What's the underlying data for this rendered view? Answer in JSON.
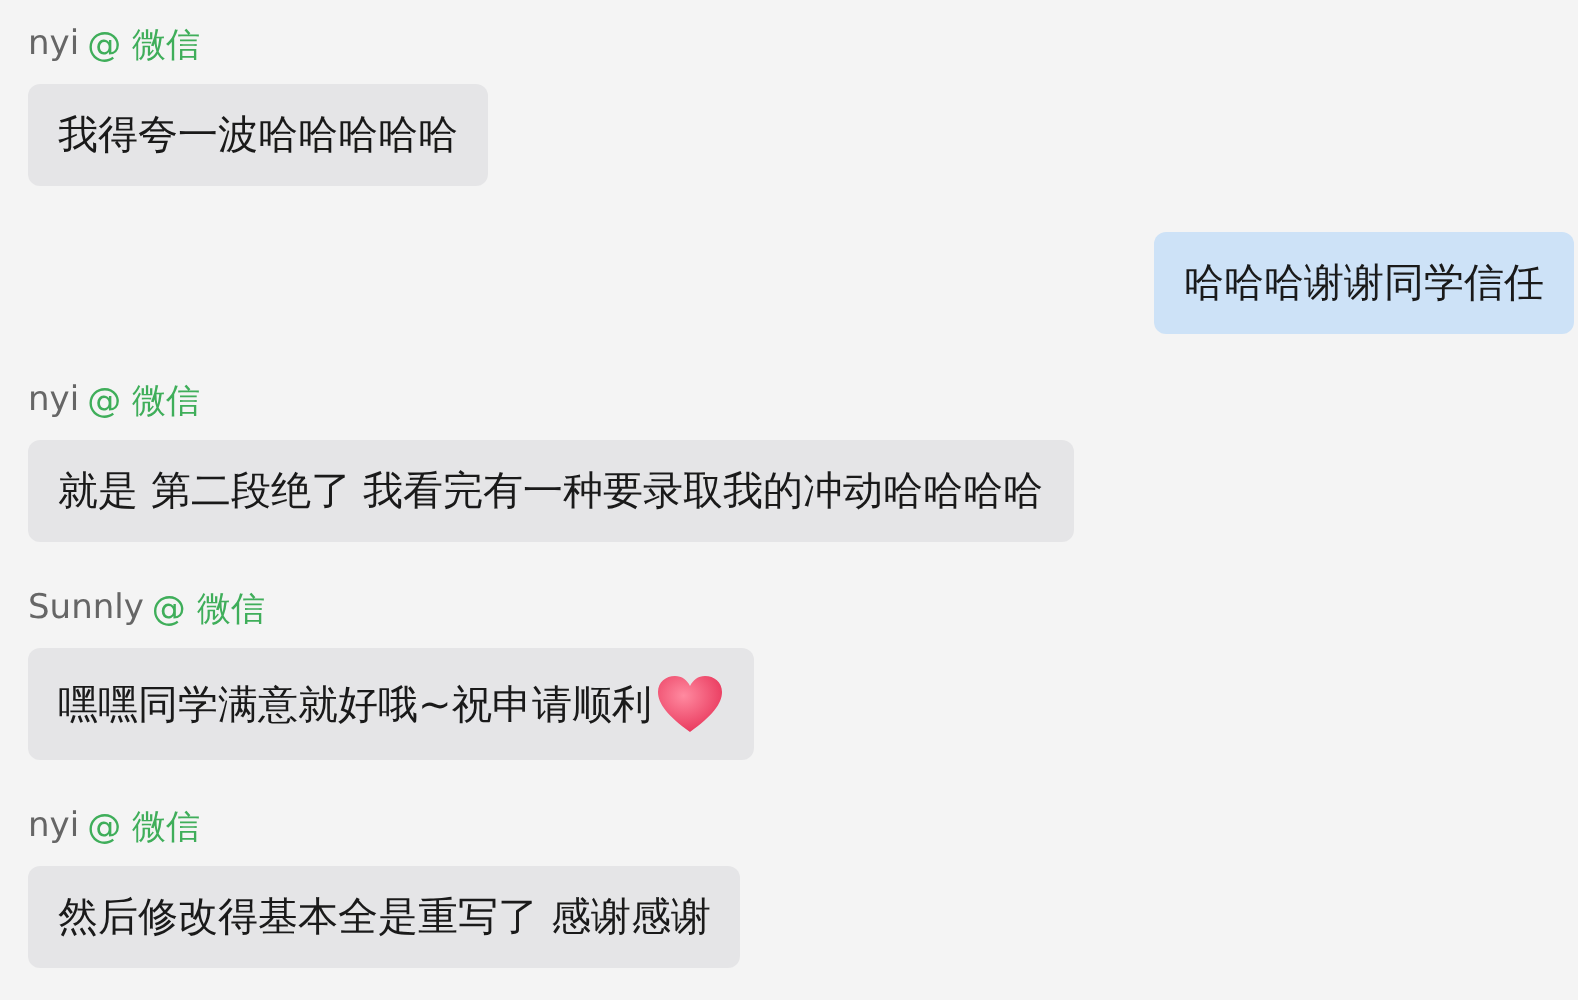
{
  "messages": [
    {
      "kind": "incoming",
      "sender": "nyi",
      "source": "@ 微信",
      "text": "我得夸一波哈哈哈哈哈"
    },
    {
      "kind": "outgoing",
      "text": "哈哈哈谢谢同学信任"
    },
    {
      "kind": "incoming",
      "sender": "nyi",
      "source": "@ 微信",
      "text": "就是 第二段绝了 我看完有一种要录取我的冲动哈哈哈哈"
    },
    {
      "kind": "incoming",
      "sender": "Sunnly",
      "source": "@ 微信",
      "text": "嘿嘿同学满意就好哦~祝申请顺利",
      "heart": true
    },
    {
      "kind": "incoming",
      "sender": "nyi",
      "source": "@ 微信",
      "text": "然后修改得基本全是重写了 感谢感谢"
    }
  ]
}
